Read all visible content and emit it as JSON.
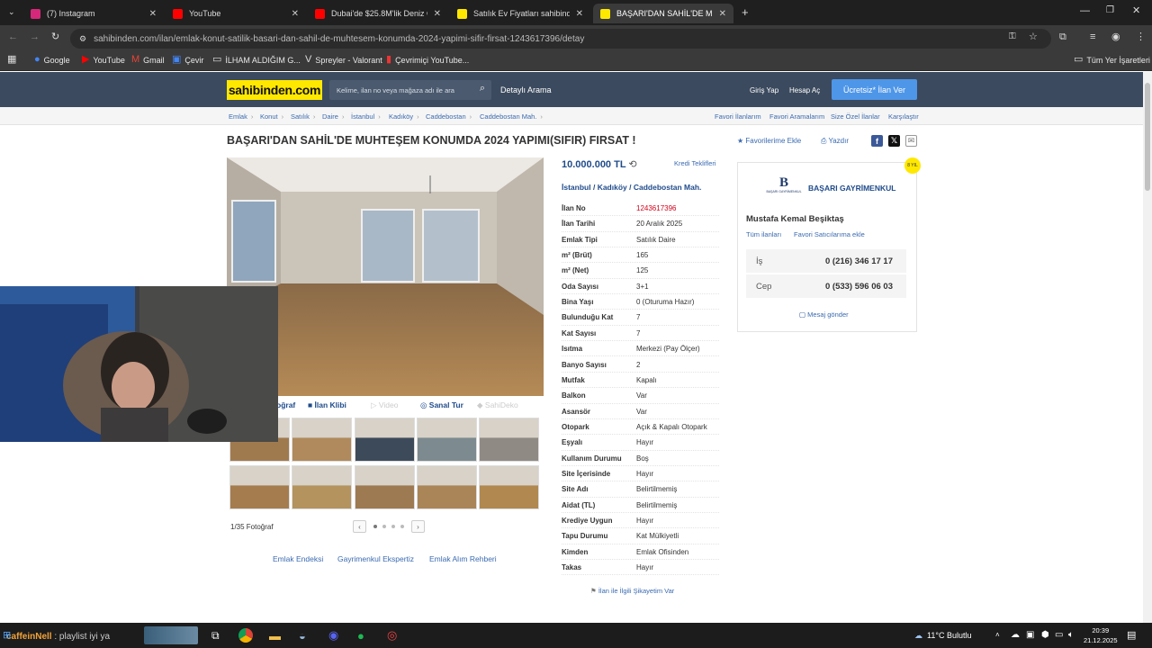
{
  "tabs": [
    {
      "title": "(7) Instagram",
      "color": "#d6287a"
    },
    {
      "title": "YouTube",
      "color": "#ff0000"
    },
    {
      "title": "Dubai'de $25.8M'lik Deniz Önü",
      "color": "#ff0000"
    },
    {
      "title": "Satılık Ev Fiyatları sahibinden.co",
      "color": "#ffe800"
    },
    {
      "title": "BAŞARI'DAN SAHİL'DE MUHTEŞ",
      "color": "#ffe800"
    }
  ],
  "url": "sahibinden.com/ilan/emlak-konut-satilik-basari-dan-sahil-de-muhtesem-konumda-2024-yapimi-sifir-firsat-1243617396/detay",
  "bookmarks": [
    "Google",
    "YouTube",
    "Gmail",
    "Çevir",
    "İLHAM ALDIĞIM G...",
    "Spreyler - Valorant",
    "Çevrimiçi YouTube..."
  ],
  "all_bookmarks": "Tüm Yer İşaretleri",
  "header": {
    "logo": "sahibinden.com",
    "search_placeholder": "Kelime, ilan no veya mağaza adı ile ara",
    "detayli": "Detaylı Arama",
    "giris": "Giriş Yap",
    "hesap": "Hesap Aç",
    "ilan_ver": "Ücretsiz* İlan Ver"
  },
  "breadcrumbs": [
    "Emlak",
    "Konut",
    "Satılık",
    "Daire",
    "İstanbul",
    "Kadıköy",
    "Caddebostan",
    "Caddebostan Mah."
  ],
  "right_links": [
    "Favori İlanlarım",
    "Favori Aramalarım",
    "Size Özel İlanlar",
    "Karşılaştır"
  ],
  "listing": {
    "title": "BAŞARI'DAN SAHİL'DE MUHTEŞEM KONUMDA 2024 YAPIMI(SIFIR) FIRSAT !",
    "fav_add": "Favorilerime Ekle",
    "print": "Yazdır",
    "price": "10.000.000 TL",
    "kredi": "Kredi Teklifleri",
    "location": [
      "İstanbul",
      "Kadıköy",
      "Caddebostan Mah."
    ],
    "details": [
      {
        "k": "İlan No",
        "v": "1243617396",
        "red": true
      },
      {
        "k": "İlan Tarihi",
        "v": "20 Aralık 2025"
      },
      {
        "k": "Emlak Tipi",
        "v": "Satılık Daire"
      },
      {
        "k": "m² (Brüt)",
        "v": "165"
      },
      {
        "k": "m² (Net)",
        "v": "125"
      },
      {
        "k": "Oda Sayısı",
        "v": "3+1"
      },
      {
        "k": "Bina Yaşı",
        "v": "0 (Oturuma Hazır)"
      },
      {
        "k": "Bulunduğu Kat",
        "v": "7"
      },
      {
        "k": "Kat Sayısı",
        "v": "7"
      },
      {
        "k": "Isıtma",
        "v": "Merkezi (Pay Ölçer)"
      },
      {
        "k": "Banyo Sayısı",
        "v": "2"
      },
      {
        "k": "Mutfak",
        "v": "Kapalı"
      },
      {
        "k": "Balkon",
        "v": "Var"
      },
      {
        "k": "Asansör",
        "v": "Var"
      },
      {
        "k": "Otopark",
        "v": "Açık & Kapalı Otopark"
      },
      {
        "k": "Eşyalı",
        "v": "Hayır"
      },
      {
        "k": "Kullanım Durumu",
        "v": "Boş"
      },
      {
        "k": "Site İçerisinde",
        "v": "Hayır"
      },
      {
        "k": "Site Adı",
        "v": "Belirtilmemiş"
      },
      {
        "k": "Aidat (TL)",
        "v": "Belirtilmemiş"
      },
      {
        "k": "Krediye Uygun",
        "v": "Hayır"
      },
      {
        "k": "Tapu Durumu",
        "v": "Kat Mülkiyetli"
      },
      {
        "k": "Kimden",
        "v": "Emlak Ofisinden"
      },
      {
        "k": "Takas",
        "v": "Hayır"
      }
    ],
    "sikayet": "İlan ile İlgili Şikayetim Var"
  },
  "gallery": {
    "buttons": [
      "oğraf",
      "İlan Klibi",
      "Video",
      "Sanal Tur",
      "SahiDeko"
    ],
    "count": "1/35 Fotoğraf",
    "thumb_colors": [
      "#a07a4f",
      "#b08a5c",
      "#3d4a5a",
      "#7d8a8f",
      "#8f8a84",
      "#a57c4e",
      "#b4935f",
      "#9e7a52",
      "#a98557",
      "#b08850"
    ]
  },
  "bottom_links": [
    "Emlak Endeksi",
    "Gayrimenkul Ekspertiz",
    "Emlak Alım Rehberi"
  ],
  "seller": {
    "agency": "BAŞARI GAYRİMENKUL",
    "logo_text": "BAŞARI GAYRİMENKUL",
    "agent": "Mustafa Kemal Beşiktaş",
    "all_listings": "Tüm ilanları",
    "fav_seller": "Favori Satıcılarıma ekle",
    "phones": [
      {
        "k": "İş",
        "v": "0 (216) 346 17 17"
      },
      {
        "k": "Cep",
        "v": "0 (533) 596 06 03"
      }
    ],
    "message": "Mesaj gönder",
    "badge": "8 YIL"
  },
  "chat": {
    "user": "caffeinNell",
    "message": " : playlist iyi ya"
  },
  "taskbar": {
    "weather": "11°C Bulutlu",
    "time": "20:39",
    "date": "21.12.2025"
  }
}
